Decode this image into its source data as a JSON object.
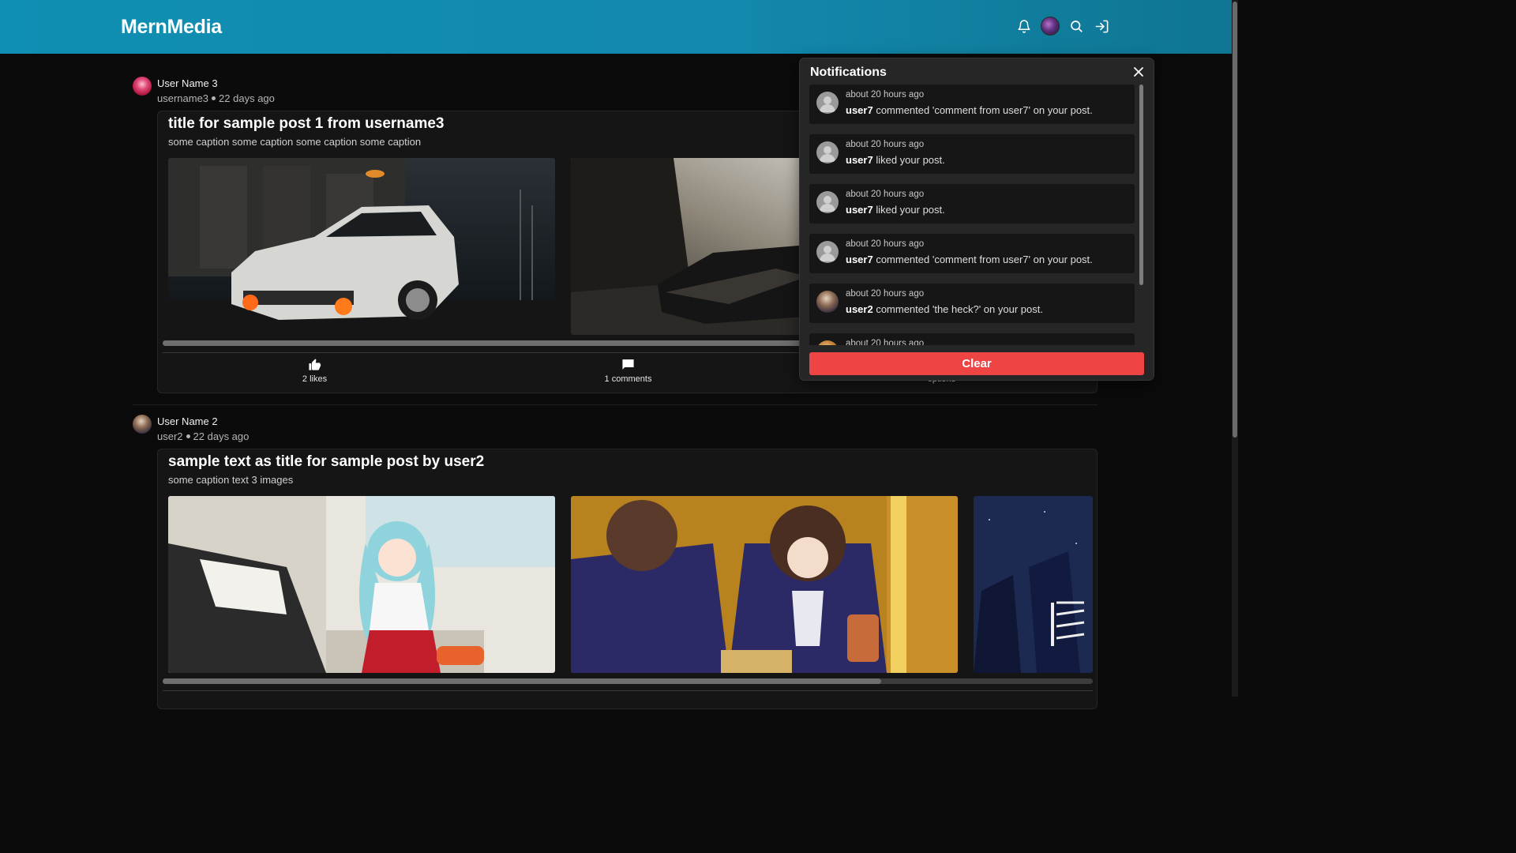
{
  "header": {
    "brand": "MernMedia",
    "icons": [
      "bell-icon",
      "avatar",
      "search-icon",
      "logout-icon"
    ]
  },
  "posts": [
    {
      "author_name": "User Name 3",
      "username": "username3",
      "time": "22 days ago",
      "title": "title for sample post 1 from username3",
      "caption": "some caption some caption some caption some caption",
      "images": [
        "white car at night",
        "car drifting on road"
      ],
      "likes": "2 likes",
      "comments": "1 comments",
      "options": "options"
    },
    {
      "author_name": "User Name 2",
      "username": "user2",
      "time": "22 days ago",
      "title": "sample text as title for sample post by user2",
      "caption": "some caption text 3 images",
      "images": [
        "anime girl at piano",
        "anime characters at mirror",
        "anime characters night sky"
      ]
    }
  ],
  "notifications": {
    "title": "Notifications",
    "items": [
      {
        "time": "about 20 hours ago",
        "user": "user7",
        "text": " commented 'comment from user7' on your post."
      },
      {
        "time": "about 20 hours ago",
        "user": "user7",
        "text": " liked your post."
      },
      {
        "time": "about 20 hours ago",
        "user": "user7",
        "text": " liked your post."
      },
      {
        "time": "about 20 hours ago",
        "user": "user7",
        "text": " commented 'comment from user7' on your post."
      },
      {
        "time": "about 20 hours ago",
        "user": "user2",
        "text": " commented 'the heck?' on your post."
      },
      {
        "time": "about 20 hours ago",
        "user": "",
        "text": ""
      }
    ],
    "clear_label": "Clear"
  },
  "colors": {
    "header": "#1288ac",
    "background": "#0b0b0b",
    "clear_button": "#ef4444"
  }
}
